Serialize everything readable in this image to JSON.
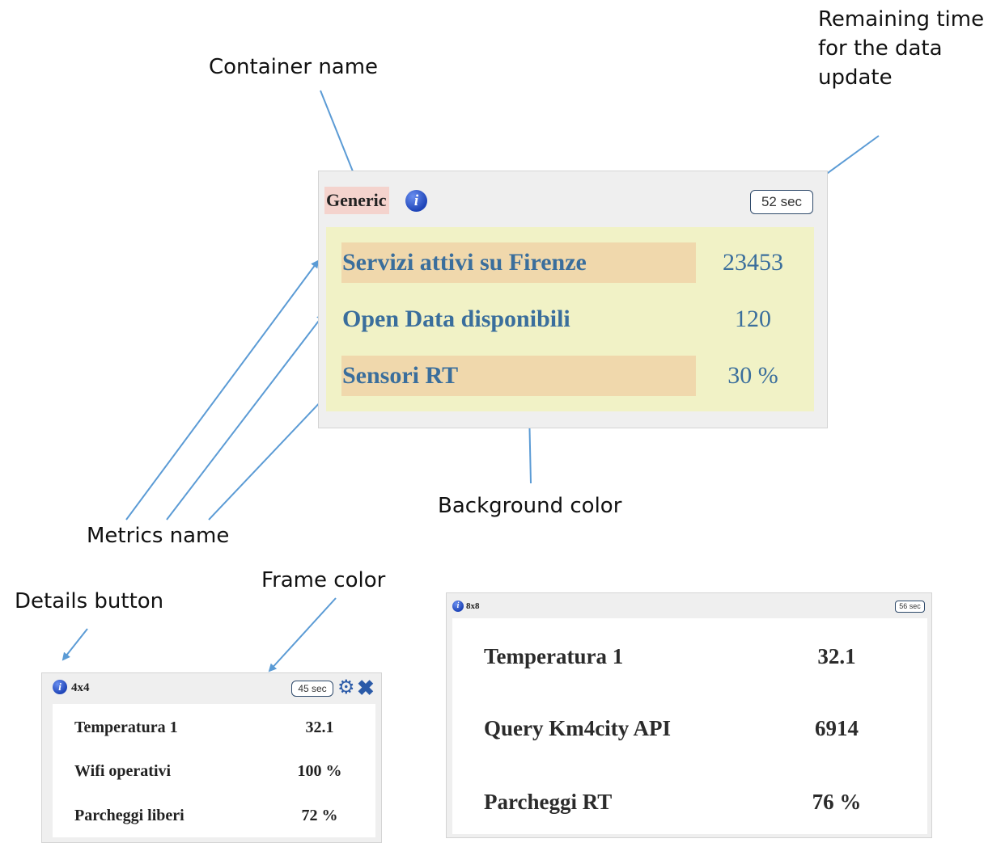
{
  "annotations": {
    "container_name": "Container name",
    "remaining_time": [
      "Remaining time",
      "for the data",
      "update"
    ],
    "background_color": "Background color",
    "metrics_name": "Metrics name",
    "frame_color": "Frame color",
    "details_button": "Details button"
  },
  "colors": {
    "arrow": "#5b9bd5",
    "widget_frame": "#efefef",
    "title_highlight": "#f4d3cd",
    "generic_background": "#f1f2c6",
    "row_highlight": "#f0d8ac",
    "metric_text": "#3a6e9c",
    "info_icon": "#1f45b8"
  },
  "widget_generic": {
    "title": "Generic",
    "info_icon": "info-icon",
    "timer": "52 sec",
    "rows": [
      {
        "name": "Servizi attivi su Firenze",
        "value": "23453"
      },
      {
        "name": "Open Data disponibili",
        "value": "120"
      },
      {
        "name": "Sensori RT",
        "value": "30 %"
      }
    ]
  },
  "widget_4x4": {
    "title": "4x4",
    "info_icon": "info-icon",
    "timer": "45 sec",
    "gear_icon": "gear-icon",
    "close_icon": "close-icon",
    "rows": [
      {
        "name": "Temperatura 1",
        "value": "32.1"
      },
      {
        "name": "Wifi operativi",
        "value": "100 %"
      },
      {
        "name": "Parcheggi liberi",
        "value": "72 %"
      }
    ]
  },
  "widget_8x8": {
    "title": "8x8",
    "info_icon": "info-icon",
    "timer": "56 sec",
    "rows": [
      {
        "name": "Temperatura 1",
        "value": "32.1"
      },
      {
        "name": "Query Km4city API",
        "value": "6914"
      },
      {
        "name": "Parcheggi RT",
        "value": "76 %"
      }
    ]
  }
}
